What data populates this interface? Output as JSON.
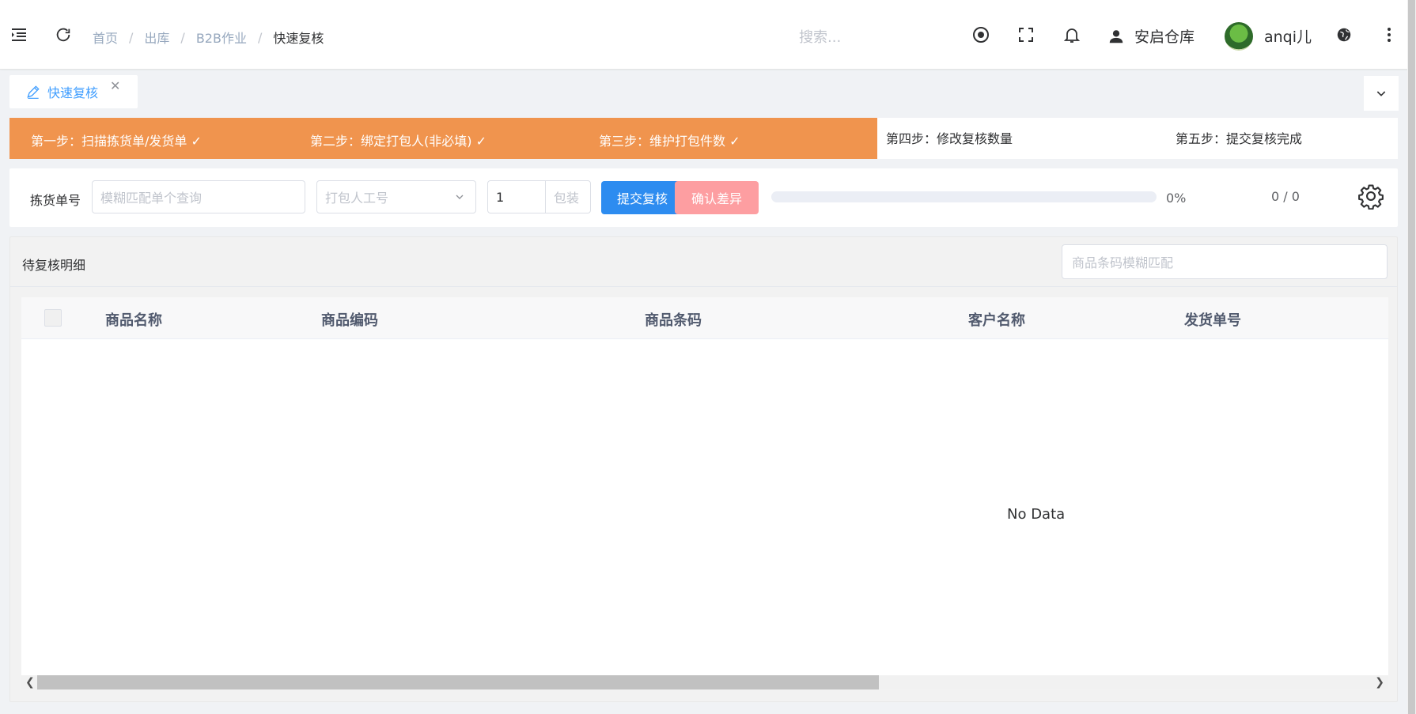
{
  "header": {
    "breadcrumb": [
      "首页",
      "出库",
      "B2B作业",
      "快速复核"
    ],
    "search_placeholder": "搜索...",
    "warehouse": "安启仓库",
    "username": "anqi儿"
  },
  "tags": {
    "active_label": "快速复核"
  },
  "steps": [
    {
      "label": "第一步：扫描拣货单/发货单 ✓",
      "done": true
    },
    {
      "label": "第二步：绑定打包人(非必填) ✓",
      "done": true
    },
    {
      "label": "第三步：维护打包件数 ✓",
      "done": true
    },
    {
      "label": "第四步：修改复核数量",
      "done": false
    },
    {
      "label": "第五步：提交复核完成",
      "done": false
    }
  ],
  "toolbar": {
    "pick_label": "拣货单号",
    "pick_placeholder": "模糊匹配单个查询",
    "packer_placeholder": "打包人工号",
    "package_count": "1",
    "package_placeholder": "包装",
    "submit_label": "提交复核",
    "confirm_label": "确认差异",
    "progress_percent": 0,
    "progress_text": "0%",
    "count_text": "0 / 0"
  },
  "detail": {
    "title": "待复核明细",
    "barcode_placeholder": "商品条码模糊匹配",
    "columns": [
      "商品名称",
      "商品编码",
      "商品条码",
      "客户名称",
      "发货单号"
    ],
    "rows": [],
    "empty_text": "No Data"
  }
}
